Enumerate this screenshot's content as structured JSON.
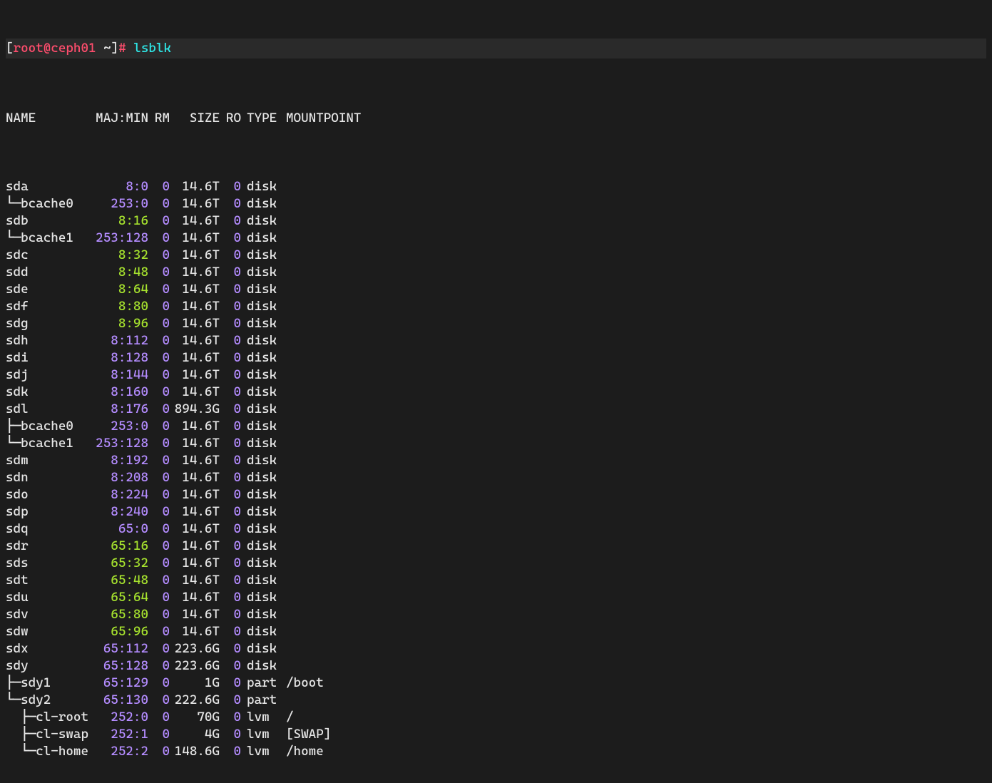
{
  "prompt": {
    "bracket_open": "[",
    "user_host": "root@ceph01",
    "cwd": " ~",
    "bracket_close": "]",
    "hash": "# ",
    "command": "lsblk"
  },
  "headers": {
    "name": "NAME",
    "majmin": "MAJ:MIN",
    "rm": "RM",
    "size": "SIZE",
    "ro": "RO",
    "type": "TYPE",
    "mountpoint": "MOUNTPOINT"
  },
  "rows": [
    {
      "name": "sda",
      "maj": "8:0",
      "maj_c": "purple",
      "rm": "0",
      "rm_c": "purple",
      "size": "14.6T",
      "ro": "0",
      "ro_c": "purple",
      "type": "disk",
      "mnt": ""
    },
    {
      "name": "└─bcache0",
      "maj": "253:0",
      "maj_c": "purple",
      "rm": "0",
      "rm_c": "purple",
      "size": "14.6T",
      "ro": "0",
      "ro_c": "purple",
      "type": "disk",
      "mnt": ""
    },
    {
      "name": "sdb",
      "maj": "8:16",
      "maj_c": "green",
      "rm": "0",
      "rm_c": "purple",
      "size": "14.6T",
      "ro": "0",
      "ro_c": "purple",
      "type": "disk",
      "mnt": ""
    },
    {
      "name": "└─bcache1",
      "maj": "253:128",
      "maj_c": "purple",
      "rm": "0",
      "rm_c": "purple",
      "size": "14.6T",
      "ro": "0",
      "ro_c": "purple",
      "type": "disk",
      "mnt": ""
    },
    {
      "name": "sdc",
      "maj": "8:32",
      "maj_c": "green",
      "rm": "0",
      "rm_c": "purple",
      "size": "14.6T",
      "ro": "0",
      "ro_c": "purple",
      "type": "disk",
      "mnt": ""
    },
    {
      "name": "sdd",
      "maj": "8:48",
      "maj_c": "green",
      "rm": "0",
      "rm_c": "purple",
      "size": "14.6T",
      "ro": "0",
      "ro_c": "purple",
      "type": "disk",
      "mnt": ""
    },
    {
      "name": "sde",
      "maj": "8:64",
      "maj_c": "green",
      "rm": "0",
      "rm_c": "purple",
      "size": "14.6T",
      "ro": "0",
      "ro_c": "purple",
      "type": "disk",
      "mnt": ""
    },
    {
      "name": "sdf",
      "maj": "8:80",
      "maj_c": "green",
      "rm": "0",
      "rm_c": "purple",
      "size": "14.6T",
      "ro": "0",
      "ro_c": "purple",
      "type": "disk",
      "mnt": ""
    },
    {
      "name": "sdg",
      "maj": "8:96",
      "maj_c": "green",
      "rm": "0",
      "rm_c": "purple",
      "size": "14.6T",
      "ro": "0",
      "ro_c": "purple",
      "type": "disk",
      "mnt": ""
    },
    {
      "name": "sdh",
      "maj": "8:112",
      "maj_c": "purple",
      "rm": "0",
      "rm_c": "purple",
      "size": "14.6T",
      "ro": "0",
      "ro_c": "purple",
      "type": "disk",
      "mnt": ""
    },
    {
      "name": "sdi",
      "maj": "8:128",
      "maj_c": "purple",
      "rm": "0",
      "rm_c": "purple",
      "size": "14.6T",
      "ro": "0",
      "ro_c": "purple",
      "type": "disk",
      "mnt": ""
    },
    {
      "name": "sdj",
      "maj": "8:144",
      "maj_c": "purple",
      "rm": "0",
      "rm_c": "purple",
      "size": "14.6T",
      "ro": "0",
      "ro_c": "purple",
      "type": "disk",
      "mnt": ""
    },
    {
      "name": "sdk",
      "maj": "8:160",
      "maj_c": "purple",
      "rm": "0",
      "rm_c": "purple",
      "size": "14.6T",
      "ro": "0",
      "ro_c": "purple",
      "type": "disk",
      "mnt": ""
    },
    {
      "name": "sdl",
      "maj": "8:176",
      "maj_c": "purple",
      "rm": "0",
      "rm_c": "purple",
      "size": "894.3G",
      "ro": "0",
      "ro_c": "purple",
      "type": "disk",
      "mnt": ""
    },
    {
      "name": "├─bcache0",
      "maj": "253:0",
      "maj_c": "purple",
      "rm": "0",
      "rm_c": "purple",
      "size": "14.6T",
      "ro": "0",
      "ro_c": "purple",
      "type": "disk",
      "mnt": ""
    },
    {
      "name": "└─bcache1",
      "maj": "253:128",
      "maj_c": "purple",
      "rm": "0",
      "rm_c": "purple",
      "size": "14.6T",
      "ro": "0",
      "ro_c": "purple",
      "type": "disk",
      "mnt": ""
    },
    {
      "name": "sdm",
      "maj": "8:192",
      "maj_c": "purple",
      "rm": "0",
      "rm_c": "purple",
      "size": "14.6T",
      "ro": "0",
      "ro_c": "purple",
      "type": "disk",
      "mnt": ""
    },
    {
      "name": "sdn",
      "maj": "8:208",
      "maj_c": "purple",
      "rm": "0",
      "rm_c": "purple",
      "size": "14.6T",
      "ro": "0",
      "ro_c": "purple",
      "type": "disk",
      "mnt": ""
    },
    {
      "name": "sdo",
      "maj": "8:224",
      "maj_c": "purple",
      "rm": "0",
      "rm_c": "purple",
      "size": "14.6T",
      "ro": "0",
      "ro_c": "purple",
      "type": "disk",
      "mnt": ""
    },
    {
      "name": "sdp",
      "maj": "8:240",
      "maj_c": "purple",
      "rm": "0",
      "rm_c": "purple",
      "size": "14.6T",
      "ro": "0",
      "ro_c": "purple",
      "type": "disk",
      "mnt": ""
    },
    {
      "name": "sdq",
      "maj": "65:0",
      "maj_c": "purple",
      "rm": "0",
      "rm_c": "purple",
      "size": "14.6T",
      "ro": "0",
      "ro_c": "purple",
      "type": "disk",
      "mnt": ""
    },
    {
      "name": "sdr",
      "maj": "65:16",
      "maj_c": "green",
      "rm": "0",
      "rm_c": "purple",
      "size": "14.6T",
      "ro": "0",
      "ro_c": "purple",
      "type": "disk",
      "mnt": ""
    },
    {
      "name": "sds",
      "maj": "65:32",
      "maj_c": "green",
      "rm": "0",
      "rm_c": "purple",
      "size": "14.6T",
      "ro": "0",
      "ro_c": "purple",
      "type": "disk",
      "mnt": ""
    },
    {
      "name": "sdt",
      "maj": "65:48",
      "maj_c": "green",
      "rm": "0",
      "rm_c": "purple",
      "size": "14.6T",
      "ro": "0",
      "ro_c": "purple",
      "type": "disk",
      "mnt": ""
    },
    {
      "name": "sdu",
      "maj": "65:64",
      "maj_c": "green",
      "rm": "0",
      "rm_c": "purple",
      "size": "14.6T",
      "ro": "0",
      "ro_c": "purple",
      "type": "disk",
      "mnt": ""
    },
    {
      "name": "sdv",
      "maj": "65:80",
      "maj_c": "green",
      "rm": "0",
      "rm_c": "purple",
      "size": "14.6T",
      "ro": "0",
      "ro_c": "purple",
      "type": "disk",
      "mnt": ""
    },
    {
      "name": "sdw",
      "maj": "65:96",
      "maj_c": "green",
      "rm": "0",
      "rm_c": "purple",
      "size": "14.6T",
      "ro": "0",
      "ro_c": "purple",
      "type": "disk",
      "mnt": ""
    },
    {
      "name": "sdx",
      "maj": "65:112",
      "maj_c": "purple",
      "rm": "0",
      "rm_c": "purple",
      "size": "223.6G",
      "ro": "0",
      "ro_c": "purple",
      "type": "disk",
      "mnt": ""
    },
    {
      "name": "sdy",
      "maj": "65:128",
      "maj_c": "purple",
      "rm": "0",
      "rm_c": "purple",
      "size": "223.6G",
      "ro": "0",
      "ro_c": "purple",
      "type": "disk",
      "mnt": ""
    },
    {
      "name": "├─sdy1",
      "maj": "65:129",
      "maj_c": "purple",
      "rm": "0",
      "rm_c": "purple",
      "size": "1G",
      "ro": "0",
      "ro_c": "purple",
      "type": "part",
      "mnt": "/boot"
    },
    {
      "name": "└─sdy2",
      "maj": "65:130",
      "maj_c": "purple",
      "rm": "0",
      "rm_c": "purple",
      "size": "222.6G",
      "ro": "0",
      "ro_c": "purple",
      "type": "part",
      "mnt": ""
    },
    {
      "name": "  ├─cl-root",
      "maj": "252:0",
      "maj_c": "purple",
      "rm": "0",
      "rm_c": "purple",
      "size": "70G",
      "ro": "0",
      "ro_c": "purple",
      "type": "lvm",
      "mnt": "/"
    },
    {
      "name": "  ├─cl-swap",
      "maj": "252:1",
      "maj_c": "purple",
      "rm": "0",
      "rm_c": "purple",
      "size": "4G",
      "ro": "0",
      "ro_c": "purple",
      "type": "lvm",
      "mnt": "[SWAP]",
      "mnt_c": "yellow"
    },
    {
      "name": "  └─cl-home",
      "maj": "252:2",
      "maj_c": "purple",
      "rm": "0",
      "rm_c": "purple",
      "size": "148.6G",
      "ro": "0",
      "ro_c": "purple",
      "type": "lvm",
      "mnt": "/home"
    }
  ]
}
